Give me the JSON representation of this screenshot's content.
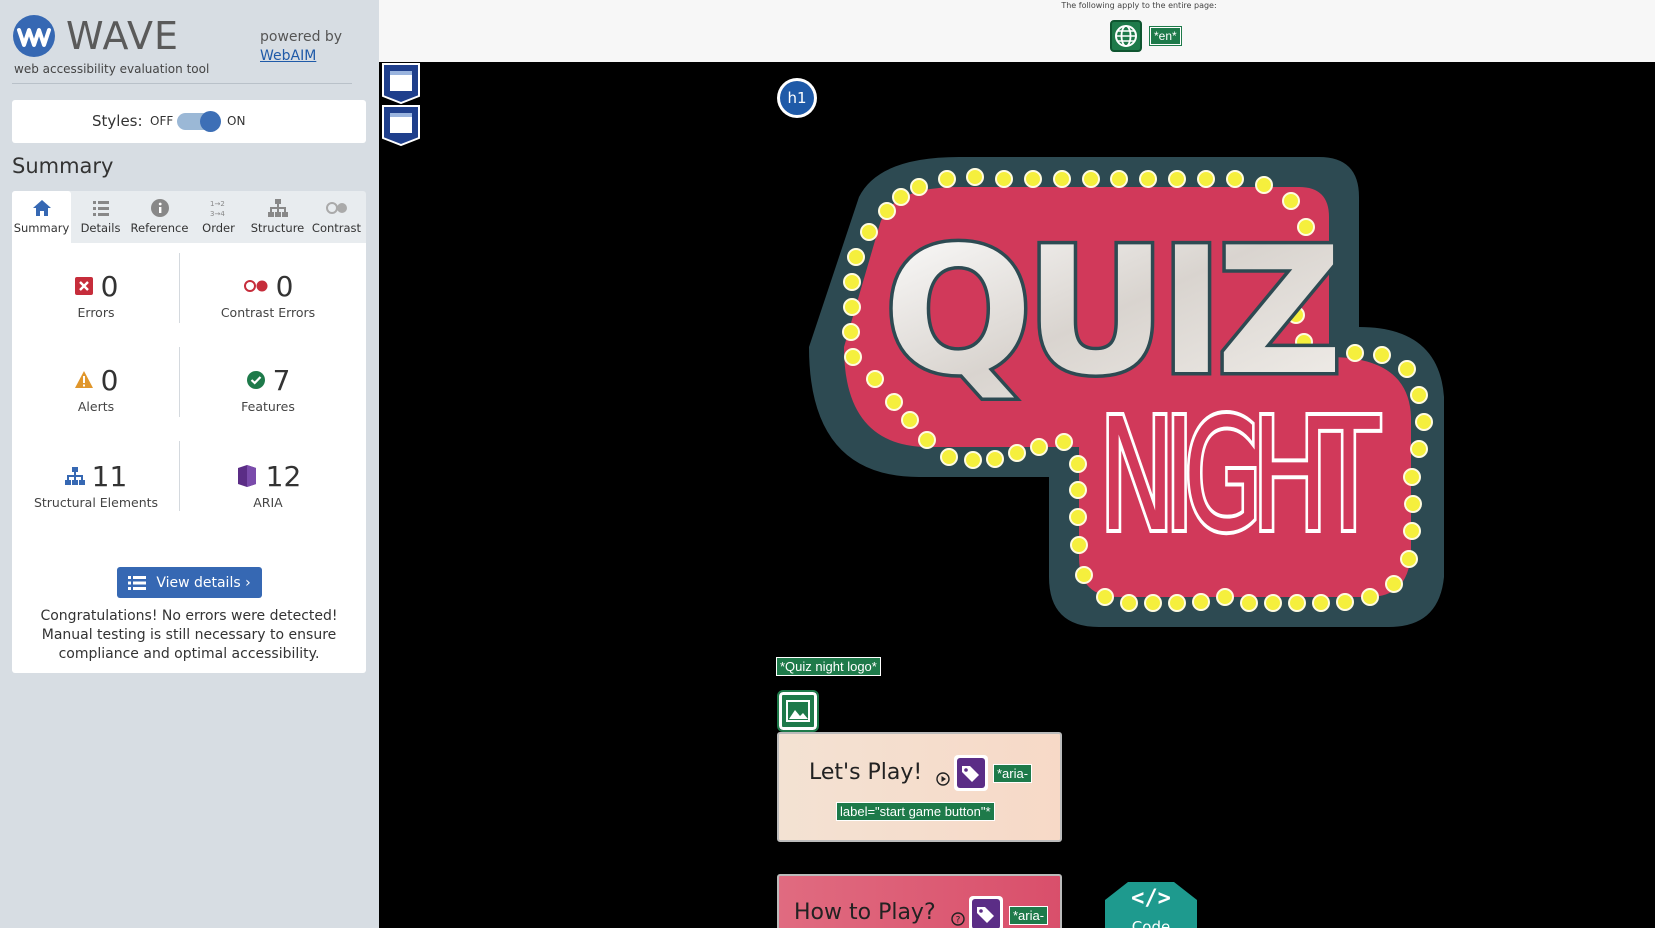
{
  "sidebar": {
    "brand": {
      "name": "WAVE",
      "tagline": "web accessibility evaluation tool",
      "powered_by": "powered by",
      "webaim_link": "WebAIM"
    },
    "styles_toggle": {
      "label": "Styles:",
      "off": "OFF",
      "on": "ON",
      "state": "on"
    },
    "heading": "Summary",
    "tabs": [
      {
        "label": "Summary",
        "icon": "home-icon",
        "active": true
      },
      {
        "label": "Details",
        "icon": "list-icon",
        "active": false
      },
      {
        "label": "Reference",
        "icon": "info-icon",
        "active": false
      },
      {
        "label": "Order",
        "icon": "order-icon",
        "active": false
      },
      {
        "label": "Structure",
        "icon": "structure-icon",
        "active": false
      },
      {
        "label": "Contrast",
        "icon": "contrast-icon",
        "active": false
      }
    ],
    "stats": {
      "errors": {
        "value": "0",
        "label": "Errors",
        "icon": "error-icon"
      },
      "contrast_errors": {
        "value": "0",
        "label": "Contrast Errors",
        "icon": "contrast-error-icon"
      },
      "alerts": {
        "value": "0",
        "label": "Alerts",
        "icon": "alert-icon"
      },
      "features": {
        "value": "7",
        "label": "Features",
        "icon": "feature-check-icon"
      },
      "structural": {
        "value": "11",
        "label": "Structural Elements",
        "icon": "structure-icon"
      },
      "aria": {
        "value": "12",
        "label": "ARIA",
        "icon": "aria-icon"
      }
    },
    "view_details_label": "View details ›",
    "congrats": "Congratulations! No errors were detected! Manual testing is still necessary to ensure compliance and optimal accessibility."
  },
  "pagebar": {
    "note": "The following apply to the entire page:",
    "lang_tag": "*en*"
  },
  "page": {
    "h1_badge": "h1",
    "logo_line1": "QUIZ",
    "logo_line2": "NIGHT",
    "logo_alt_tag": "*Quiz night logo*",
    "play_button": {
      "label": "Let's Play!",
      "tag1": "*aria-",
      "tag2": "label=\"start game button\"*"
    },
    "how_button": {
      "label": "How to Play?",
      "tag1": "*aria-"
    },
    "code_button": {
      "symbol": "</>",
      "label": "Code"
    }
  },
  "colors": {
    "wave_blue": "#3668b3",
    "feature_green": "#1e7a4a",
    "error_red": "#c62d3b",
    "alert_orange": "#e0962b",
    "aria_purple": "#5b2d86",
    "logo_red": "#d1395a",
    "logo_teal": "#2d4a52",
    "bulb_yellow": "#f5ef3d"
  }
}
